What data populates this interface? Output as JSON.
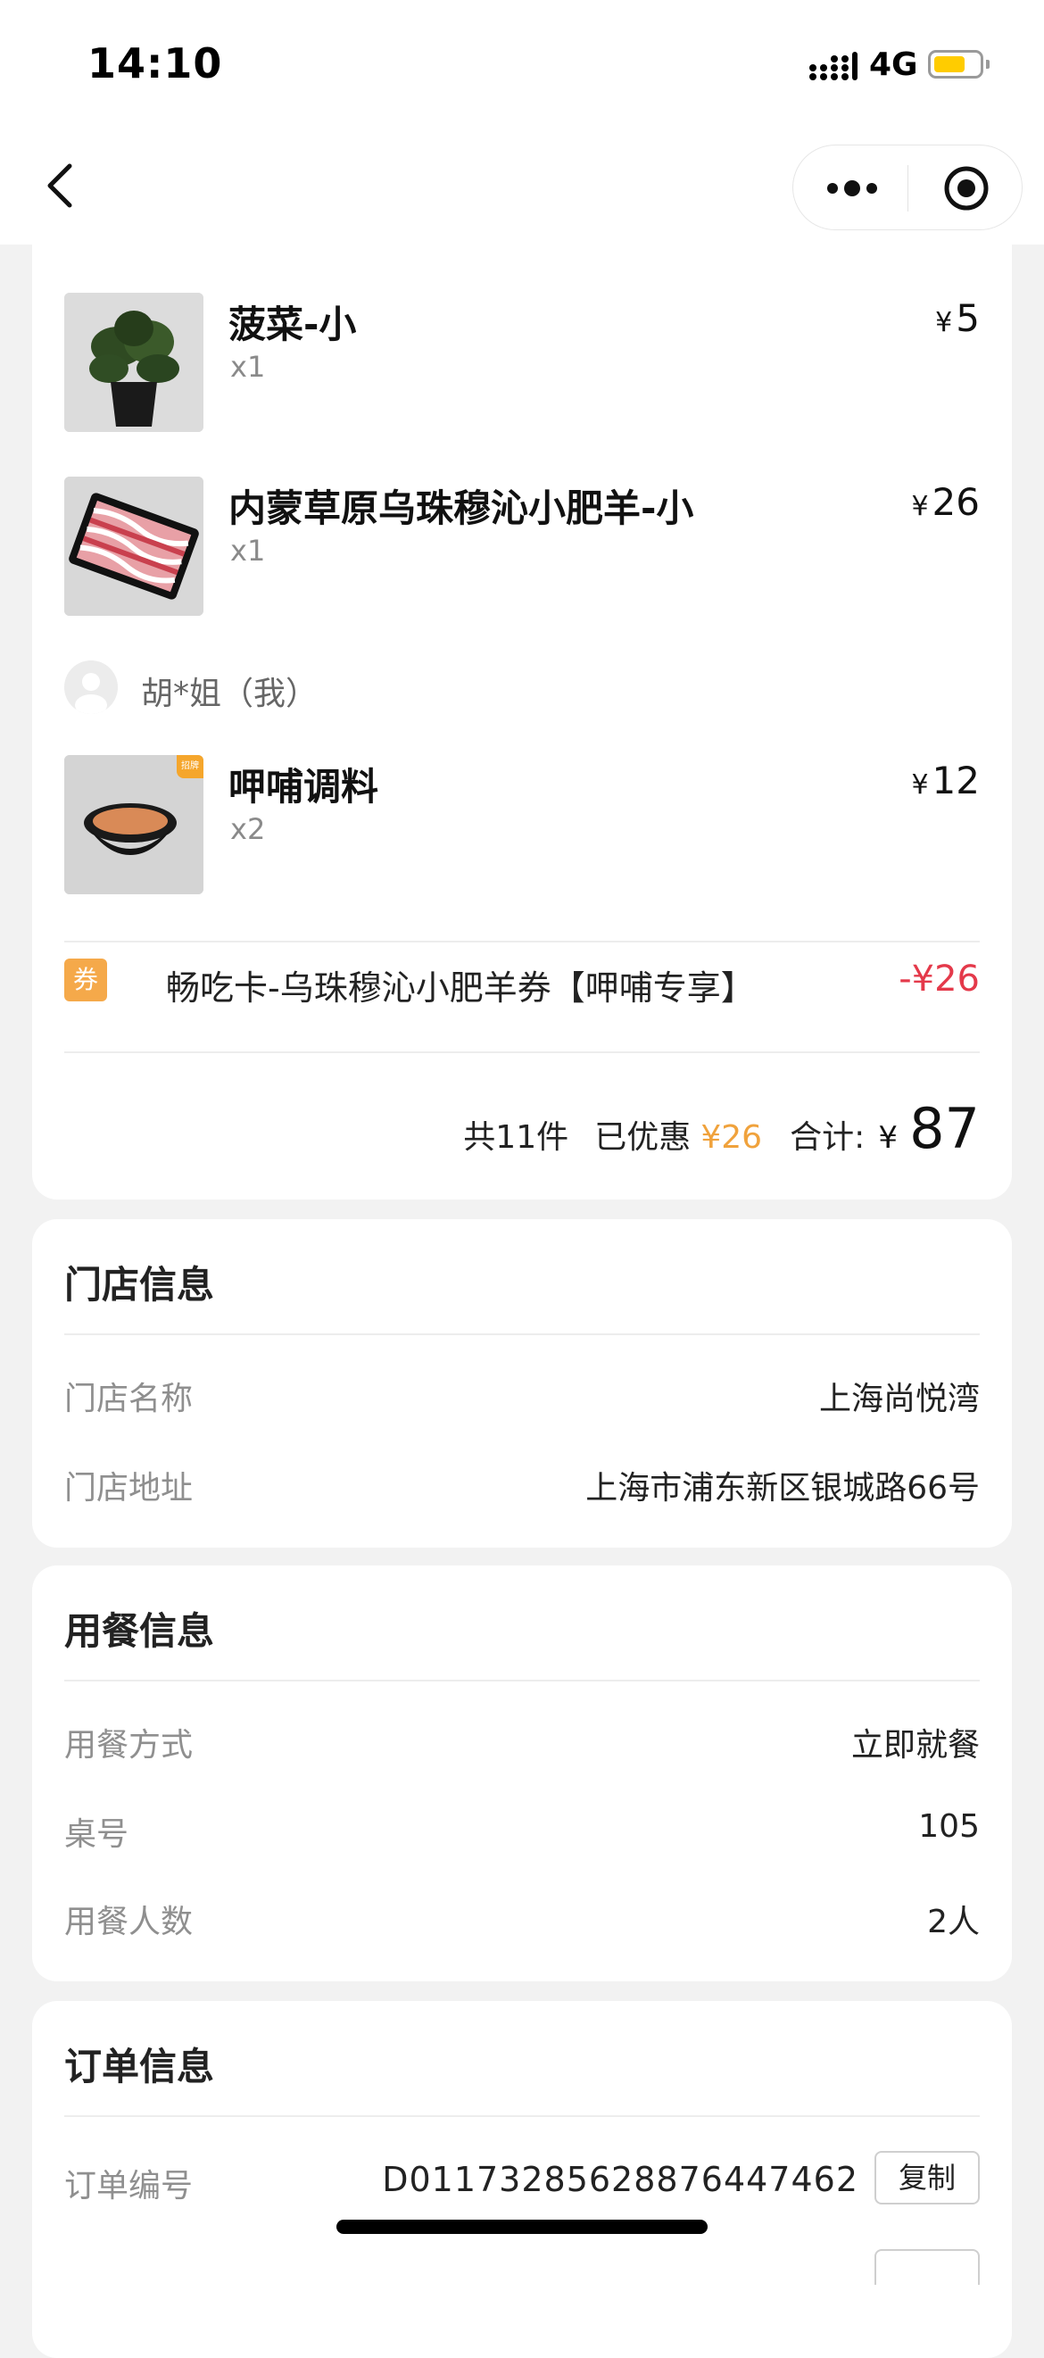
{
  "status_bar": {
    "time": "14:10",
    "network": "4G"
  },
  "items": [
    {
      "name": "菠菜-小",
      "qty": "x1",
      "currency": "¥",
      "price": "5",
      "image": "spinach"
    },
    {
      "name": "内蒙草原乌珠穆沁小肥羊-小",
      "qty": "x1",
      "currency": "¥",
      "price": "26",
      "image": "lamb-slices"
    }
  ],
  "person": {
    "name": "胡*姐（我）"
  },
  "items2": [
    {
      "name": "呷哺调料",
      "qty": "x2",
      "currency": "¥",
      "price": "12",
      "badge": "招牌",
      "image": "sauce-bowl"
    }
  ],
  "coupon": {
    "tag": "券",
    "name": "畅吃卡-乌珠穆沁小肥羊券【呷哺专享】",
    "amount": "-¥26"
  },
  "summary": {
    "count": "共11件",
    "discount_label": "已优惠",
    "discount_value": "¥26",
    "total_label": "合计:",
    "currency": "¥",
    "total": "87"
  },
  "store_info": {
    "title": "门店信息",
    "rows": [
      {
        "label": "门店名称",
        "value": "上海尚悦湾"
      },
      {
        "label": "门店地址",
        "value": "上海市浦东新区银城路66号"
      }
    ]
  },
  "dining_info": {
    "title": "用餐信息",
    "rows": [
      {
        "label": "用餐方式",
        "value": "立即就餐"
      },
      {
        "label": "桌号",
        "value": "105"
      },
      {
        "label": "用餐人数",
        "value": "2人"
      }
    ]
  },
  "order_info": {
    "title": "订单信息",
    "rows": [
      {
        "label": "订单编号",
        "value": "D01173285628876447462",
        "button": "复制"
      }
    ]
  },
  "colors": {
    "accent_orange": "#f0a23c",
    "coupon_red": "#e4394a",
    "battery_yellow": "#ffcc00",
    "background": "#f2f2f2"
  }
}
